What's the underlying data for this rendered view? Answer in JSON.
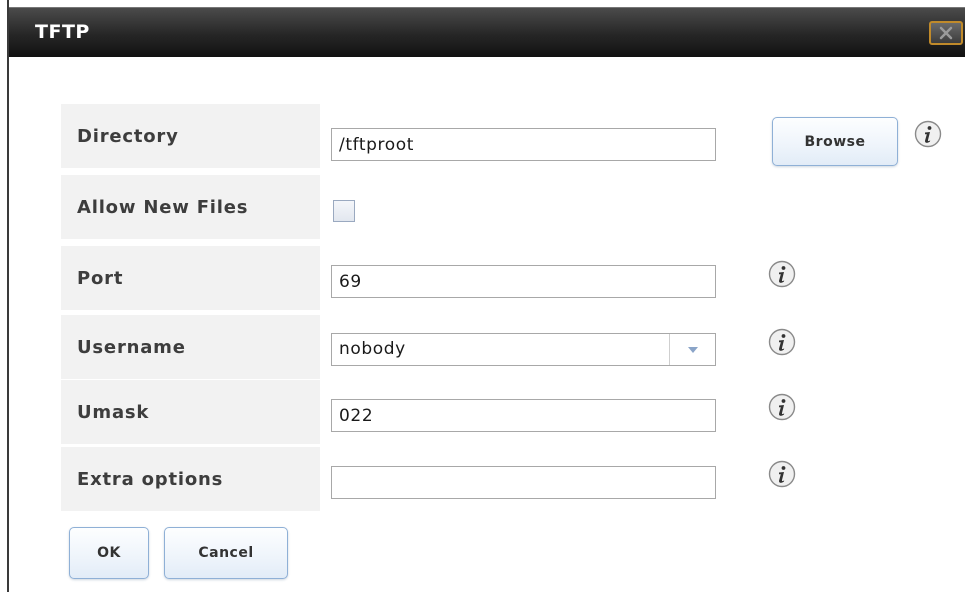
{
  "dialog": {
    "title": "TFTP",
    "close_icon": "close-icon"
  },
  "fields": {
    "directory": {
      "label": "Directory",
      "value": "/tftproot",
      "browse_label": "Browse"
    },
    "allow_new_files": {
      "label": "Allow New Files",
      "checked": false
    },
    "port": {
      "label": "Port",
      "value": "69"
    },
    "username": {
      "label": "Username",
      "value": "nobody"
    },
    "umask": {
      "label": "Umask",
      "value": "022"
    },
    "extra_options": {
      "label": "Extra options",
      "value": ""
    }
  },
  "buttons": {
    "ok_label": "OK",
    "cancel_label": "Cancel"
  },
  "icons": {
    "info": "info-icon",
    "dropdown": "chevron-down-icon"
  },
  "colors": {
    "title_bar": "#262626",
    "label_bg": "#f2f2f2",
    "button_border": "#8fb0d6",
    "close_border": "#c08a2a"
  }
}
